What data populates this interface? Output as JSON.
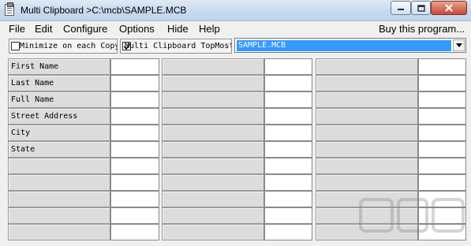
{
  "window": {
    "title": "Multi Clipboard >C:\\mcb\\SAMPLE.MCB"
  },
  "menu": {
    "items": [
      "File",
      "Edit",
      "Configure",
      "Options",
      "Hide",
      "Help"
    ],
    "right_item": "Buy this program..."
  },
  "toolbar": {
    "minimize_checkbox": {
      "label": "Minimize on each Copy",
      "checked": false
    },
    "topmost_checkbox": {
      "label": "Multi Clipboard TopMost",
      "checked": true
    },
    "file_combo": {
      "value": "SAMPLE.MCB"
    }
  },
  "grid": {
    "columns": 3,
    "rows": 11,
    "column1_labels": [
      "First Name",
      "Last Name",
      "Full Name",
      "Street Address",
      "City",
      "State",
      "",
      "",
      "",
      "",
      ""
    ]
  },
  "colors": {
    "selection": "#3399ff",
    "label_cell": "#dcdcdc",
    "close_button": "#c74a33"
  }
}
